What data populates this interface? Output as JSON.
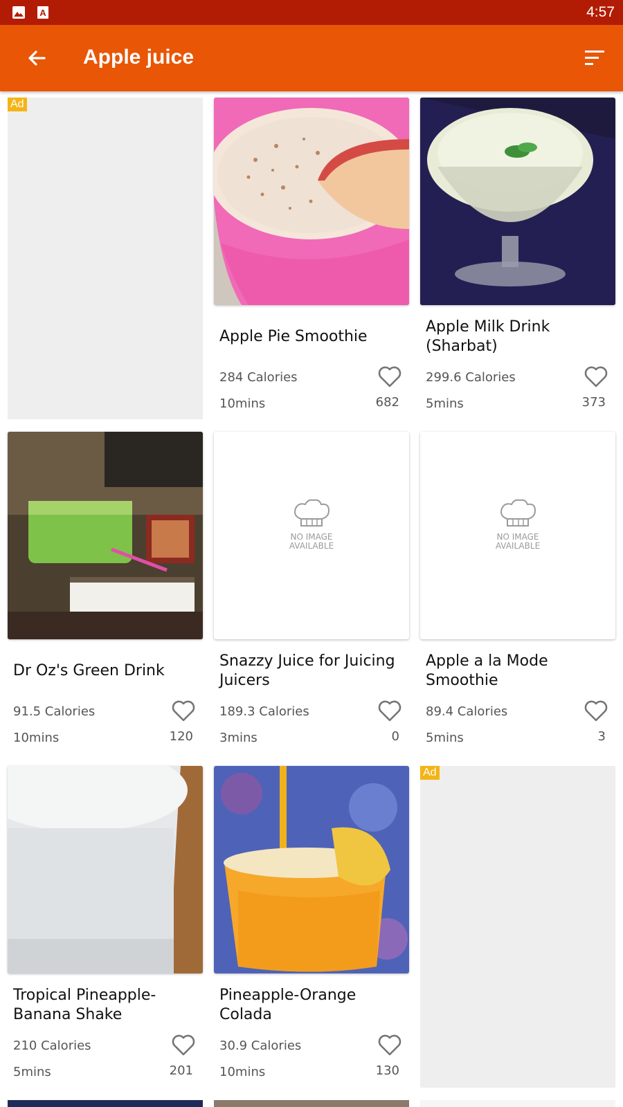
{
  "status_bar": {
    "time": "4:57",
    "icons": [
      "image-notification-icon",
      "text-notification-icon"
    ],
    "color": "#b31c04"
  },
  "app_bar": {
    "title": "Apple juice",
    "back_icon": "arrow-back-icon",
    "sort_icon": "sort-icon",
    "color": "#e85606"
  },
  "ad_label": "Ad",
  "no_image": {
    "line1": "NO IMAGE",
    "line2": "AVAILABLE"
  },
  "recipes": [
    {
      "title": "Apple Pie Smoothie",
      "calories": "284 Calories",
      "time": "10mins",
      "likes": "682"
    },
    {
      "title": "Apple Milk Drink (Sharbat)",
      "calories": "299.6 Calories",
      "time": "5mins",
      "likes": "373"
    },
    {
      "title": "Dr  Oz's Green Drink",
      "calories": "91.5 Calories",
      "time": "10mins",
      "likes": "120"
    },
    {
      "title": "Snazzy Juice for Juicing Juicers",
      "calories": "189.3 Calories",
      "time": "3mins",
      "likes": "0"
    },
    {
      "title": "Apple a la Mode Smoothie",
      "calories": "89.4 Calories",
      "time": "5mins",
      "likes": "3"
    },
    {
      "title": "Tropical Pineapple-Banana Shake",
      "calories": "210 Calories",
      "time": "5mins",
      "likes": "201"
    },
    {
      "title": "Pineapple-Orange Colada",
      "calories": "30.9 Calories",
      "time": "10mins",
      "likes": "130"
    }
  ]
}
